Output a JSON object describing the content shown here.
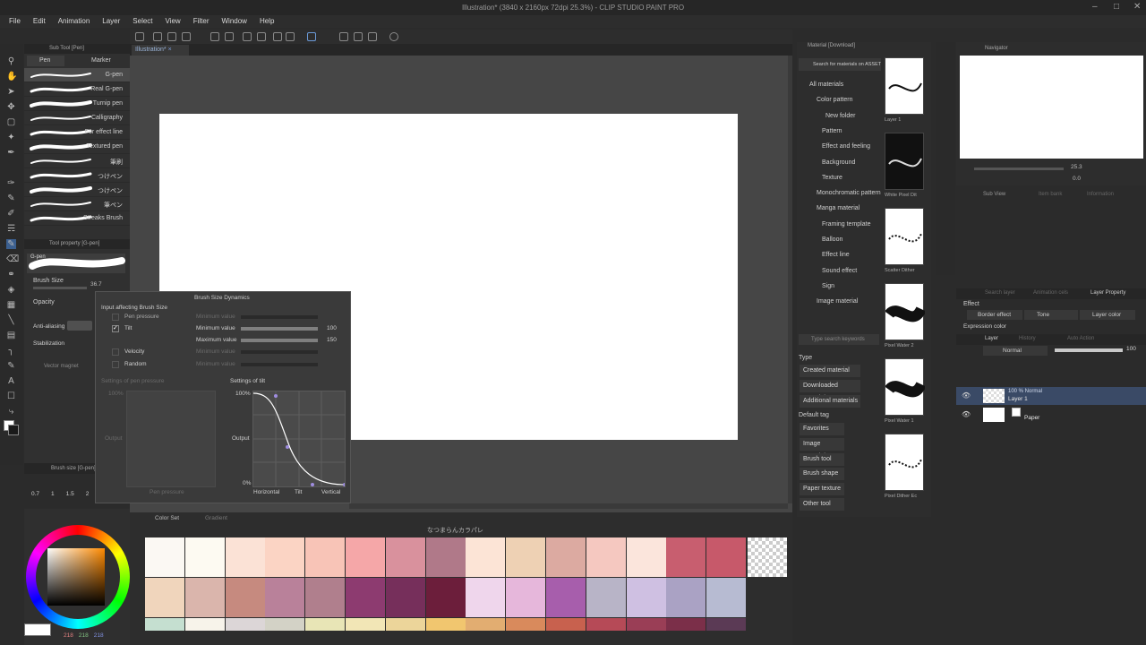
{
  "window": {
    "title": "Illustration* (3840 x 2160px 72dpi 25.3%) - CLIP STUDIO PAINT PRO"
  },
  "menu": [
    "File",
    "Edit",
    "Animation",
    "Layer",
    "Select",
    "View",
    "Filter",
    "Window",
    "Help"
  ],
  "doc_tab": "Illustration*",
  "subtool": {
    "title": "Sub Tool [Pen]",
    "tab_pen": "Pen",
    "tab_marker": "Marker",
    "brushes": [
      "G-pen",
      "Real G-pen",
      "Turnip pen",
      "Calligraphy",
      "For effect line",
      "Textured pen",
      "筆刷",
      "つけペン",
      "つけペン",
      "筆ペン",
      "Streaks Brush"
    ]
  },
  "toolprop": {
    "title": "Tool property [G-pen]",
    "preview": "G-pen",
    "brush_size_label": "Brush Size",
    "brush_size_value": "36.7",
    "opacity": "Opacity",
    "antialias": "Anti-aliasing",
    "stabilization": "Stabilization",
    "vector_magnet": "Vector magnet"
  },
  "brush_size_panel": {
    "title": "Brush size [G-pen]",
    "values": [
      "0.7",
      "1",
      "1.5",
      "2"
    ]
  },
  "dynamics": {
    "title": "Brush Size Dynamics",
    "input_label": "Input affecting Brush Size",
    "inputs": [
      "Pen pressure",
      "Tilt",
      "Velocity",
      "Random"
    ],
    "min_value": "Minimum value",
    "max_value": "Maximum value",
    "min_num": "100",
    "max_num": "150",
    "pen_settings": "Settings of pen pressure",
    "tilt_settings": "Settings of tilt",
    "output": "Output",
    "pen_pressure": "Pen pressure",
    "pct100": "100%",
    "pct0": "0%",
    "horizontal": "Horizontal",
    "tilt": "Tilt",
    "vertical": "Vertical"
  },
  "material": {
    "title": "Material [Download]",
    "search": "Search for materials on ASSETS",
    "tree": [
      "All materials",
      "Color pattern",
      "New folder",
      "Pattern",
      "Effect and feeling",
      "Background",
      "Texture",
      "Monochromatic pattern",
      "Manga material",
      "Framing template",
      "Balloon",
      "Effect line",
      "Sound effect",
      "Sign",
      "Image material"
    ],
    "keyword_placeholder": "Type search keywords",
    "type_label": "Type",
    "types": [
      "Created material",
      "Downloaded material",
      "Additional materials"
    ],
    "default_tag": "Default tag",
    "tags": [
      "Favorites",
      "Image material",
      "Brush tool",
      "Brush shape",
      "Paper texture",
      "Other tool"
    ],
    "thumbs": [
      "Layer 1",
      "White Pixel Dit",
      "Scatter Dither",
      "Pixel Water 2",
      "Pixel Water 1",
      "Pixel Dither Ec"
    ]
  },
  "navigator": {
    "title": "Navigator",
    "zoom": "25.3",
    "angle": "0.0",
    "subview": "Sub View",
    "tab2": "Item bank",
    "tab3": "Information"
  },
  "layerprop": {
    "tab1": "Search layer",
    "tab2": "Animation cels",
    "tab3": "Layer Property",
    "effect": "Effect",
    "border": "Border effect",
    "tone": "Tone",
    "layer_color": "Layer color",
    "expression": "Expression color"
  },
  "layers": {
    "tab": "Layer",
    "tab2": "History",
    "tab3": "Auto Action",
    "blend": "Normal",
    "opacity": "100",
    "items": [
      {
        "name": "Layer 1",
        "info": "100 % Normal"
      },
      {
        "name": "Paper",
        "info": ""
      }
    ]
  },
  "colorset": {
    "tab1": "Color Set",
    "tab2": "Gradient",
    "set_name": "なつまらんカラパレ",
    "row1": [
      "#fbf8f3",
      "#fdfaf2",
      "#fbe2d6",
      "#fbd4c4",
      "#f8c4b7",
      "#f5a7a8",
      "#d9919d",
      "#b07989",
      "#fce4d6",
      "#eed1b4",
      "#dcaaa1",
      "#f5c8c0",
      "#fbe5dc",
      "#c85e6f",
      "#c7596a"
    ],
    "row2": [
      "#f0d5bc",
      "#dab5ac",
      "#c68a7f",
      "#b9819a",
      "#b07f8d",
      "#8d3b70",
      "#762f5b",
      "#6c1e3b",
      "#efd6ec",
      "#e6b7db",
      "#a75eac",
      "#b8b4c7",
      "#cfc0e2",
      "#aaa2c4",
      "#b7bbd2"
    ],
    "row3": [
      "#c5dfd0",
      "#f7f3ea",
      "#dcd6d7",
      "#d3d2c6",
      "#e8e5b6",
      "#f2e6b6",
      "#ecd59a",
      "#f1c66f",
      "#e2ad71",
      "#d98a5c",
      "#c8614e",
      "#b64a57",
      "#9a3e56",
      "#7b2f49",
      "#5b3a55"
    ],
    "rgb": [
      "218",
      "218",
      "218"
    ]
  }
}
